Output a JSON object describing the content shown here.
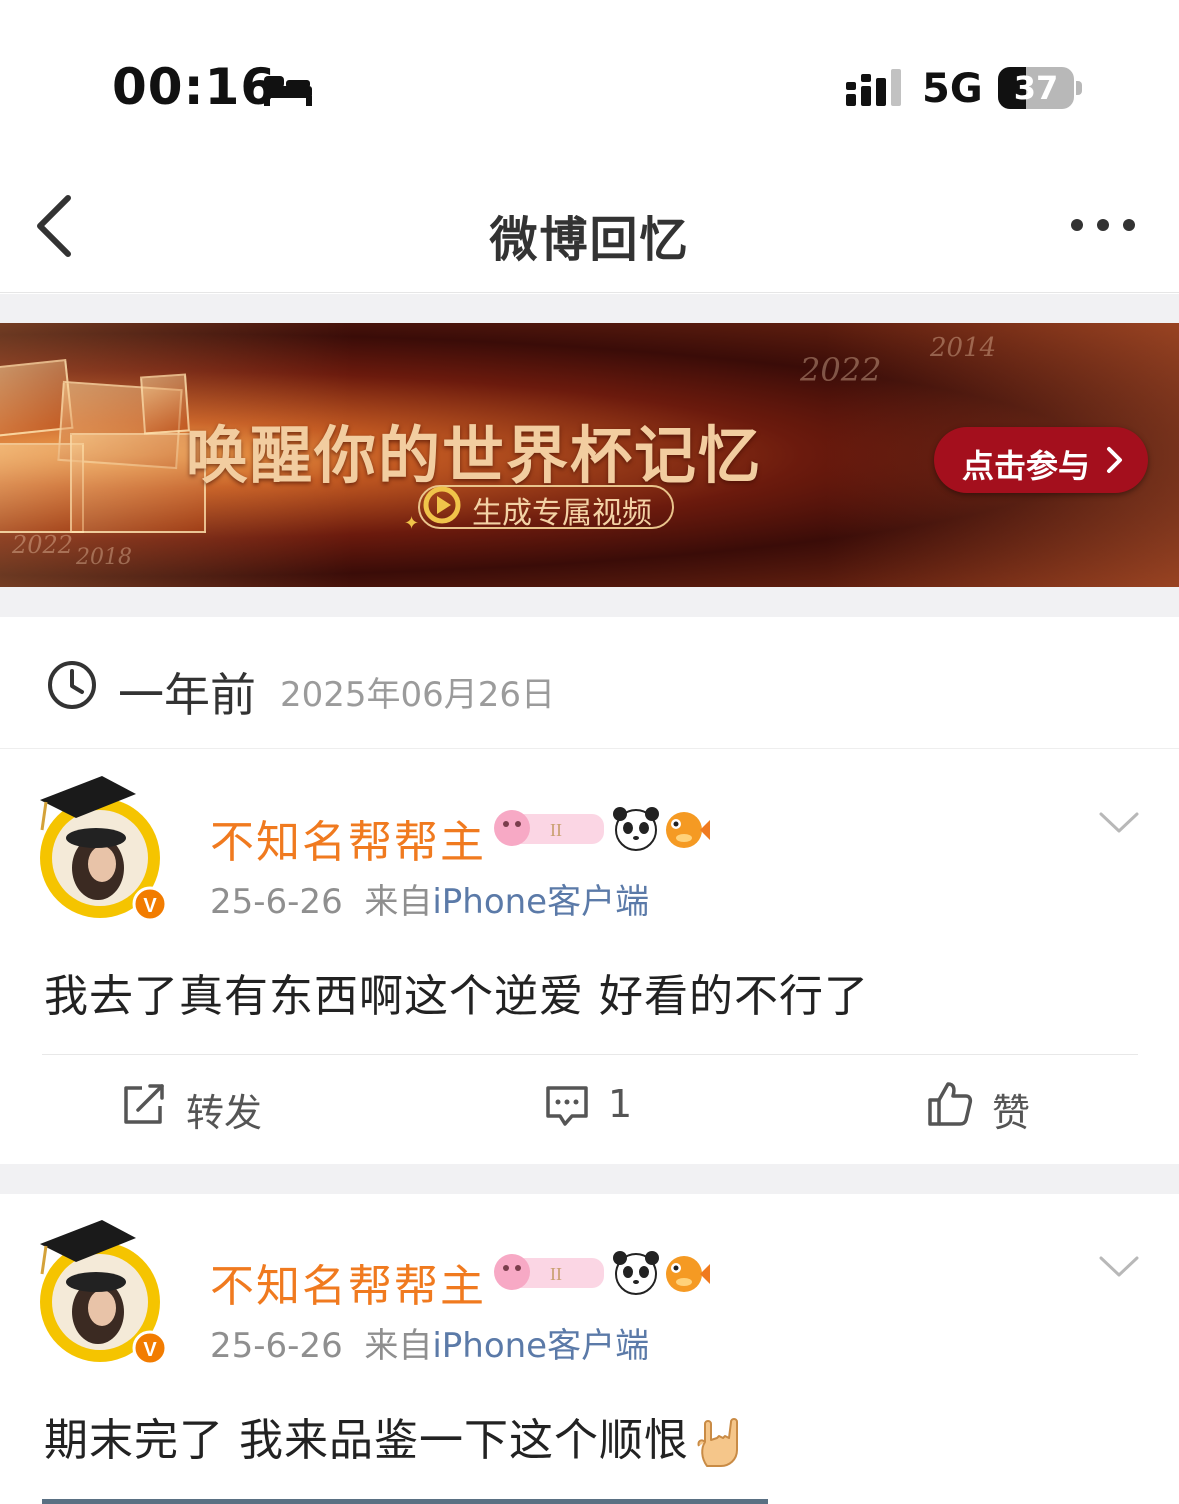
{
  "status_bar": {
    "time": "00:16",
    "network": "5G",
    "battery_level": "37",
    "battery_fraction": 0.37
  },
  "nav": {
    "title": "微博回忆",
    "back_icon": "chevron-left-icon",
    "more_icon": "more-dots-icon"
  },
  "banner": {
    "title": "唤醒你的世界杯记忆",
    "subtitle": "生成专属视频",
    "cta": "点击参与",
    "years": [
      "2014",
      "2022",
      "2022",
      "2018"
    ]
  },
  "memory": {
    "ago": "一年前",
    "date": "2025年06月26日"
  },
  "posts": [
    {
      "user": "不知名帮帮主",
      "date": "25-6-26",
      "source_prefix": "来自",
      "source": "iPhone客户端",
      "text": "我去了真有东西啊这个逆爱 好看的不行了",
      "repost_label": "转发",
      "comment_count": "1",
      "like_label": "赞"
    },
    {
      "user": "不知名帮帮主",
      "date": "25-6-26",
      "source_prefix": "来自",
      "source": "iPhone客户端",
      "text": "期末完了 我来品鉴一下这个顺恨"
    }
  ],
  "colors": {
    "username": "#f07a1f",
    "source_link": "#5b7aa8",
    "cta": "#a40f1d",
    "banner_text": "#f2cda0"
  }
}
